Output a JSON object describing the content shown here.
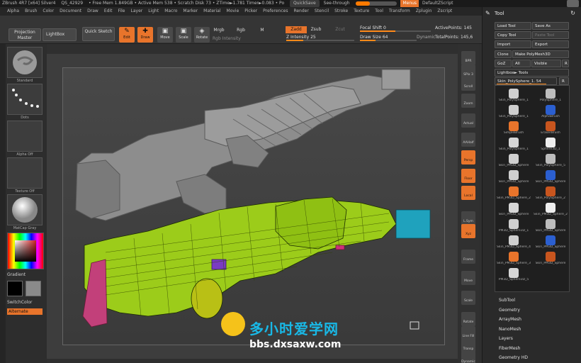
{
  "titlebar": {
    "segments": [
      "ZBrush 4R7 [x64] Silver4",
      "QS_42929",
      "• Free Mem 1.849GB • Active Mem 538 • Scratch Disk 73 • ZTime►1.781 Timer►0.083 • Po"
    ],
    "quicksave": "QuickSave",
    "seethrough": "See-through",
    "seethrough_value": 0,
    "menus": "Menus",
    "script": "DefaultZScript"
  },
  "menubar": [
    "Alpha",
    "Brush",
    "Color",
    "Document",
    "Draw",
    "Edit",
    "File",
    "Layer",
    "Light",
    "Macro",
    "Marker",
    "Material",
    "Movie",
    "Picker",
    "Preferences",
    "Render",
    "Stencil",
    "Stroke",
    "Texture",
    "Tool",
    "Transform",
    "Zplugin",
    "Zscript"
  ],
  "toptools": {
    "projection_master": "Projection Master",
    "lightbox": "LightBox",
    "quick_sketch": "Quick Sketch",
    "edit": "Edit",
    "draw": "Draw",
    "move": "Move",
    "scale": "Scale",
    "rotate": "Rotate",
    "mrgb": "Mrgb",
    "rgb": "Rgb",
    "m": "M",
    "rgb_intensity": "Rgb Intensity",
    "zadd": "Zadd",
    "zsub": "Zsub",
    "zcut": "Zcut",
    "z_intensity": "Z Intensity",
    "z_intensity_value": "25",
    "focal_shift": "Focal Shift",
    "focal_shift_value": "0",
    "draw_size": "Draw Size",
    "draw_size_value": "64",
    "dynamic": "Dynamic",
    "active_points": "ActivePoints:",
    "active_points_value": "145",
    "total_points": "TotalPoints:",
    "total_points_value": "145,6"
  },
  "leftshelf": {
    "brush_label": "Standard",
    "stroke_label": "Dots",
    "alpha_label": "Alpha Off",
    "texture_label": "Texture Off",
    "material_label": "MatCap Gray",
    "gradient": "Gradient",
    "switchcolor": "SwitchColor",
    "alternate": "Alternate"
  },
  "rightcol": [
    "BPR",
    "SPix 3",
    "Scroll",
    "Zoom",
    "Actual",
    "AAHalf",
    "Persp",
    "Floor",
    "Local",
    "L.Sym",
    "Xyz",
    "Frame",
    "Move",
    "Scale",
    "Rotate",
    "Line Fill PolyF",
    "Transp",
    "Dynamic"
  ],
  "toolpanel": {
    "title": "Tool",
    "load_tool": "Load Tool",
    "save_as": "Save As",
    "copy_tool": "Copy Tool",
    "paste_tool": "Paste Tool",
    "import": "Import",
    "export": "Export",
    "clone": "Clone",
    "make_polymesh": "Make PolyMesh3D",
    "goz": "GoZ",
    "all": "All",
    "visible": "Visible",
    "r": "R",
    "lightbox_tools": "Lightbox► Tools",
    "current_tool": "Skin_PolySphere_1. 54",
    "r2": "R",
    "subtools": [
      {
        "name": "Skin_PolySphere_1"
      },
      {
        "name": "PolySphere_1"
      },
      {
        "name": "Skin_PolySphere_1"
      },
      {
        "name": "AlphaBrush"
      },
      {
        "name": "SimpleBrush"
      },
      {
        "name": "EraserBrush"
      },
      {
        "name": "Skin_PolySphere_1"
      },
      {
        "name": "Sphere3D_1"
      },
      {
        "name": "Skin_PM3D_Sphere"
      },
      {
        "name": "Skin_PolySphere_5"
      },
      {
        "name": "Skin_PM3D_Sphere"
      },
      {
        "name": "Skin_PM3D_Sphere"
      },
      {
        "name": "Skin_PM3D_Sphere_2"
      },
      {
        "name": "Skin_PolySphere_2"
      },
      {
        "name": "Skin_PM3D_Sphere"
      },
      {
        "name": "Skin_PM3D_Sphere_2"
      },
      {
        "name": "PM3D_Sphere3D_1"
      },
      {
        "name": "Skin_PM3D_Sphere"
      },
      {
        "name": "Skin_PM3D_Sphere_4"
      },
      {
        "name": "Skin_PM3D_Sphere"
      },
      {
        "name": "Skin_PM3D_Sphere_3"
      },
      {
        "name": "Skin_PM3D_Sphere"
      },
      {
        "name": "PM3D_Sphere3D_5"
      }
    ],
    "sections": [
      "SubTool",
      "Geometry",
      "ArrayMesh",
      "NanoMesh",
      "Layers",
      "FiberMesh",
      "Geometry HD"
    ]
  },
  "watermark": {
    "cn": "多小时爱学网",
    "url": "bbs.dxsaxw.com"
  },
  "colors": {
    "accent": "#e8742b",
    "mesh_green": "#9ccc1a",
    "mesh_cyan": "#1fa2bd",
    "mesh_pink": "#c2407a",
    "gun_gray": "#8a8a8a"
  }
}
